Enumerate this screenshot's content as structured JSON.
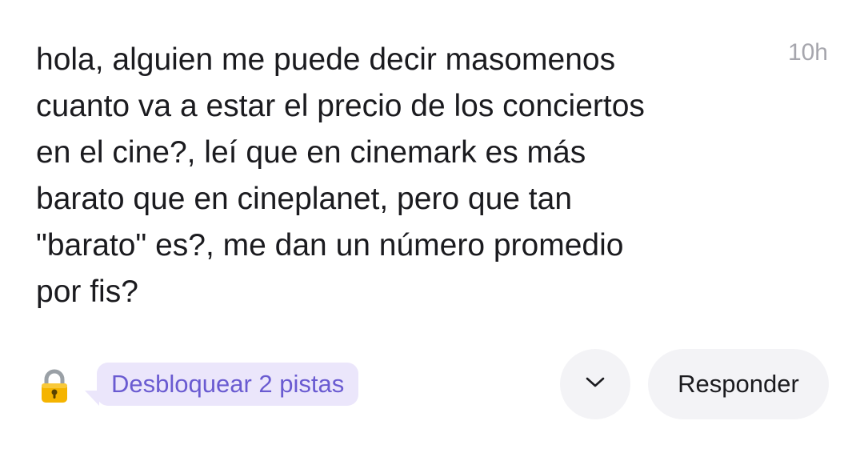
{
  "post": {
    "text": "hola, alguien me puede decir masomenos\ncuanto va a estar el precio de los conciertos\nen el cine?, leí que en cinemark es más\nbarato que en cineplanet, pero que tan\n\"barato\" es?, me dan un número promedio\npor fis?",
    "timestamp": "10h"
  },
  "footer": {
    "lock_icon": "lock-icon",
    "hint_label": "Desbloquear 2 pistas",
    "expand_icon": "chevron-down-icon",
    "reply_label": "Responder"
  },
  "colors": {
    "hint_background": "#ebe6fb",
    "hint_text": "#6a5bd1",
    "button_background": "#f3f3f6",
    "timestamp_text": "#a6a6ad"
  }
}
